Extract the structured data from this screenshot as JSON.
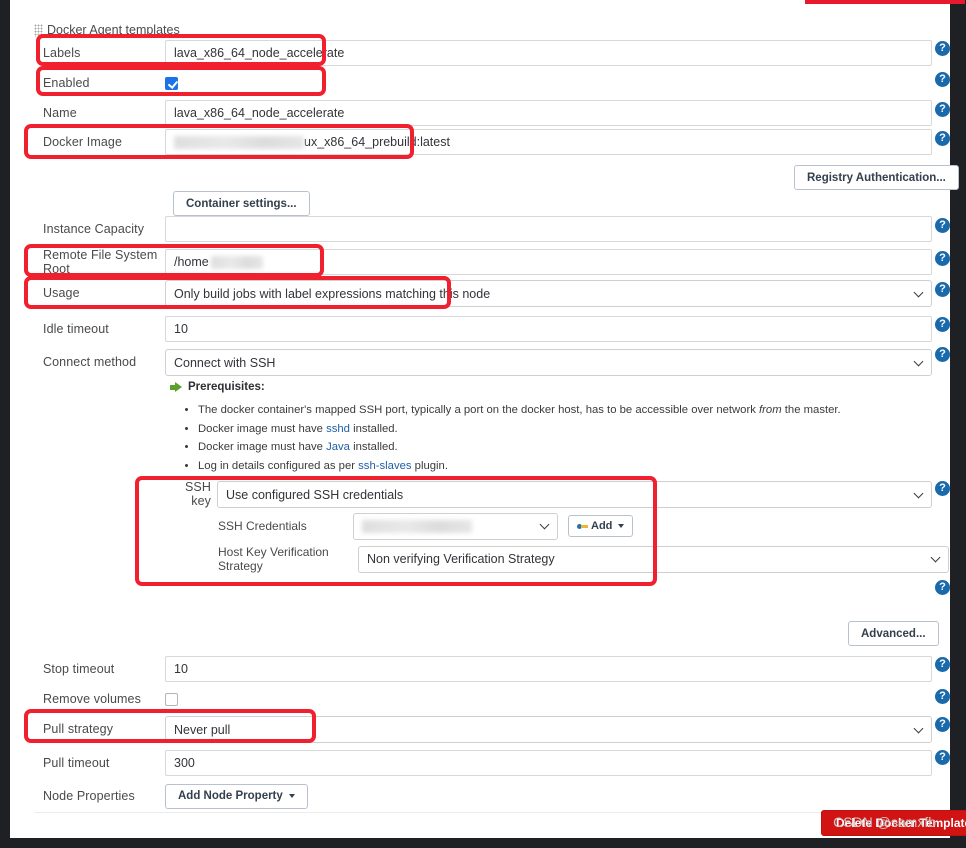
{
  "section": {
    "title": "Docker Agent templates",
    "grip_icon": "drag-grip-icon"
  },
  "fields": {
    "labels": {
      "label": "Labels",
      "value": "lava_x86_64_node_accelerate"
    },
    "enabled": {
      "label": "Enabled",
      "checked": true
    },
    "name": {
      "label": "Name",
      "value": "lava_x86_64_node_accelerate"
    },
    "docker_image": {
      "label": "Docker Image",
      "value": "ux_x86_64_prebuild:latest",
      "redacted_prefix": true
    },
    "instance_capacity": {
      "label": "Instance Capacity",
      "value": ""
    },
    "remote_fs_root": {
      "label": "Remote File System Root",
      "value": "/home",
      "redacted_suffix": true
    },
    "usage": {
      "label": "Usage",
      "value": "Only build jobs with label expressions matching this node"
    },
    "idle_timeout": {
      "label": "Idle timeout",
      "value": "10"
    },
    "connect_method": {
      "label": "Connect method",
      "value": "Connect with SSH"
    },
    "ssh_key": {
      "label": "SSH key",
      "value": "Use configured SSH credentials"
    },
    "ssh_credentials": {
      "label": "SSH Credentials",
      "value": "",
      "redacted": true
    },
    "host_key_strategy": {
      "label": "Host Key Verification Strategy",
      "value": "Non verifying Verification Strategy"
    },
    "stop_timeout": {
      "label": "Stop timeout",
      "value": "10"
    },
    "remove_volumes": {
      "label": "Remove volumes",
      "checked": false
    },
    "pull_strategy": {
      "label": "Pull strategy",
      "value": "Never pull"
    },
    "pull_timeout": {
      "label": "Pull timeout",
      "value": "300"
    },
    "node_properties": {
      "label": "Node Properties"
    }
  },
  "buttons": {
    "container_settings": "Container settings...",
    "registry_authentication": "Registry Authentication...",
    "add_credentials": "Add",
    "advanced": "Advanced...",
    "add_node_property": "Add Node Property",
    "delete_docker_template": "Delete Docker Template"
  },
  "prerequisites": {
    "heading": "Prerequisites:",
    "items": [
      {
        "parts": [
          {
            "t": "The docker container's mapped SSH port, typically a port on the docker host, has to be accessible over network ",
            "k": "text"
          },
          {
            "t": "from",
            "k": "em"
          },
          {
            "t": " the master.",
            "k": "text"
          }
        ]
      },
      {
        "parts": [
          {
            "t": "Docker image must have ",
            "k": "text"
          },
          {
            "t": "sshd",
            "k": "link"
          },
          {
            "t": " installed.",
            "k": "text"
          }
        ]
      },
      {
        "parts": [
          {
            "t": "Docker image must have ",
            "k": "text"
          },
          {
            "t": "Java",
            "k": "link"
          },
          {
            "t": " installed.",
            "k": "text"
          }
        ]
      },
      {
        "parts": [
          {
            "t": "Log in details configured as per ",
            "k": "text"
          },
          {
            "t": "ssh-slaves",
            "k": "link"
          },
          {
            "t": " plugin.",
            "k": "text"
          }
        ]
      }
    ]
  },
  "icons": {
    "help": "?",
    "help_name": "help-icon",
    "prereq_arrow": "green-arrow-icon",
    "key": "key-icon"
  },
  "watermark": "CSDN @samxfb",
  "colors": {
    "annotation_red": "#f0202e",
    "help_blue": "#1a6aab",
    "checkbox_blue": "#1a73e8",
    "danger_red": "#d11313",
    "link_blue": "#1f5fa8",
    "arrow_green": "#5aa02c"
  }
}
